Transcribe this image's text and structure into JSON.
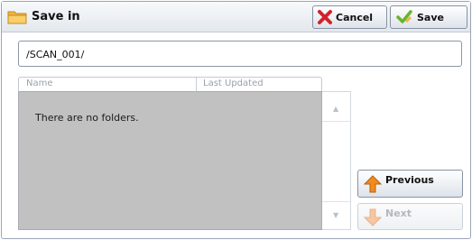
{
  "window": {
    "title": "Save in"
  },
  "toolbar": {
    "cancel_label": "Cancel",
    "save_label": "Save"
  },
  "path": {
    "value": "/SCAN_001/"
  },
  "list": {
    "columns": [
      "Name",
      "Last Updated"
    ],
    "empty_message": "There are no folders."
  },
  "pager": {
    "previous_label": "Previous",
    "next_label": "Next"
  },
  "icons": {
    "title": "folder-icon",
    "cancel": "x-icon",
    "save": "checkmark-icon",
    "previous": "arrow-up-icon",
    "next": "arrow-down-icon"
  },
  "colors": {
    "accent_folder": "#f3b443",
    "cancel_red": "#d2232a",
    "save_green": "#68b52c",
    "previous_orange": "#f08c1e",
    "list_background": "#c1c1c1"
  }
}
